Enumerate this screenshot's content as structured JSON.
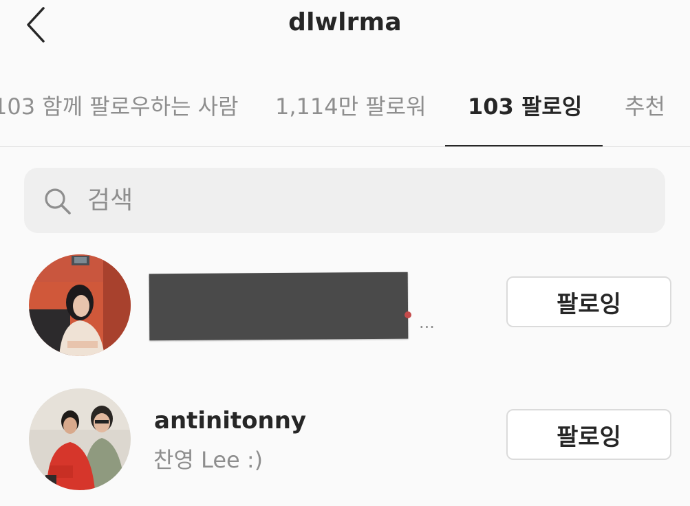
{
  "header": {
    "title": "dlwlrma",
    "back_icon": "chevron-left-icon"
  },
  "tabs": [
    {
      "label": "103 함께 팔로우하는 사람",
      "active": false
    },
    {
      "label": "1,114만 팔로워",
      "active": false
    },
    {
      "label": "103 팔로잉",
      "active": true
    },
    {
      "label": "추천",
      "active": false
    }
  ],
  "search": {
    "placeholder": "검색",
    "value": "",
    "icon": "search-icon"
  },
  "list": [
    {
      "username": "",
      "subtitle": "",
      "redacted": true,
      "ellipsis": "...",
      "button_label": "팔로잉"
    },
    {
      "username": "antinitonny",
      "subtitle": "찬영 Lee :)",
      "redacted": false,
      "button_label": "팔로잉"
    }
  ],
  "colors": {
    "background": "#fafafa",
    "text_primary": "#262626",
    "text_secondary": "#8e8e8e",
    "border": "#dbdbdb",
    "search_bg": "#efefef",
    "redaction": "#4a4a4a"
  }
}
